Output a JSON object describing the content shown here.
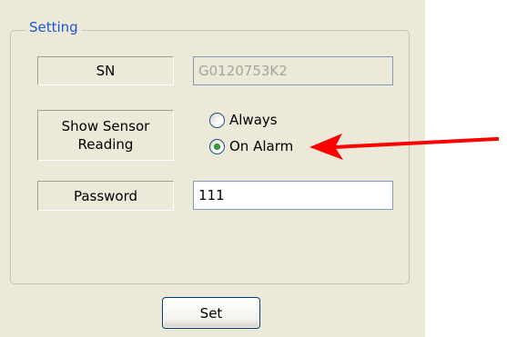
{
  "group": {
    "title": "Setting"
  },
  "labels": {
    "sn": "SN",
    "sensor_line1": "Show Sensor",
    "sensor_line2": "Reading",
    "password": "Password"
  },
  "fields": {
    "sn_value": "G0120753K2",
    "password_value": "111"
  },
  "radio": {
    "options": [
      {
        "label": "Always",
        "selected": false
      },
      {
        "label": "On Alarm",
        "selected": true
      }
    ]
  },
  "buttons": {
    "set": "Set"
  },
  "colors": {
    "panel_background": "#ece9d8",
    "group_title": "#1f54d7",
    "disabled_text": "#a7a59a",
    "radio_selected": "#35a03a",
    "arrow": "#ff0000"
  },
  "annotation": {
    "arrow_icon": "arrow-left-red",
    "target": "On Alarm"
  }
}
